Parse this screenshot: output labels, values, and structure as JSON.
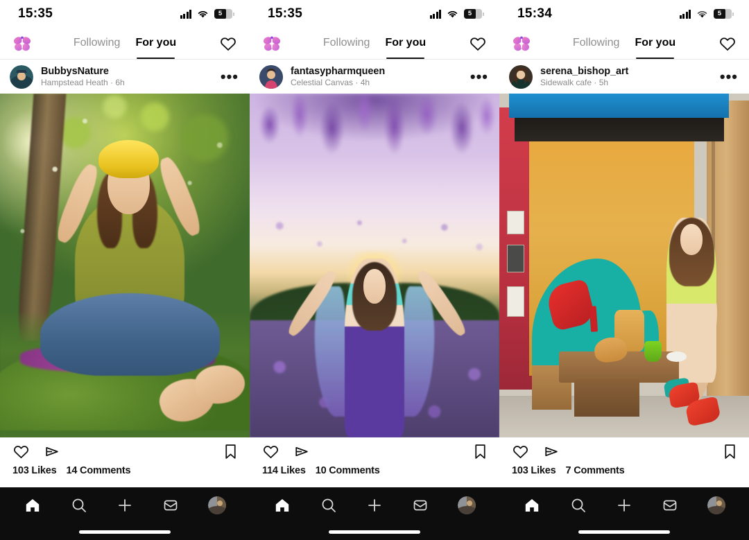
{
  "app": {
    "logo_icon": "butterfly-logo-icon",
    "accent": "#b33bd6",
    "nav_bg": "#0d0d0d"
  },
  "panels": [
    {
      "status": {
        "time": "15:35",
        "signal_icon": "cellular-signal-icon",
        "wifi_icon": "wifi-icon",
        "battery_icon": "battery-icon",
        "battery_level": "5"
      },
      "topbar": {
        "tab_following": "Following",
        "tab_for_you": "For you",
        "active_tab": "For you",
        "activity_icon": "heart-outline-icon"
      },
      "post": {
        "username": "BubbysNature",
        "subtitle": "Hampstead Heath · 6h",
        "menu_icon": "more-options-icon",
        "avatar_icon": "user-avatar",
        "like_icon": "heart-outline-icon",
        "share_icon": "share-paper-plane-icon",
        "save_icon": "bookmark-outline-icon",
        "likes": "103 Likes",
        "comments": "14 Comments",
        "image_alt": "man-meditating-in-forest"
      },
      "nav": {
        "home_icon": "home-filled-icon",
        "search_icon": "search-icon",
        "create_icon": "plus-icon",
        "inbox_icon": "inbox-tray-icon",
        "profile_icon": "profile-avatar-icon"
      }
    },
    {
      "status": {
        "time": "15:35",
        "signal_icon": "cellular-signal-icon",
        "wifi_icon": "wifi-icon",
        "battery_icon": "battery-icon",
        "battery_level": "5"
      },
      "topbar": {
        "tab_following": "Following",
        "tab_for_you": "For you",
        "active_tab": "For you",
        "activity_icon": "heart-outline-icon"
      },
      "post": {
        "username": "fantasypharmqueen",
        "subtitle": "Celestial Canvas · 4h",
        "menu_icon": "more-options-icon",
        "avatar_icon": "user-avatar",
        "like_icon": "heart-outline-icon",
        "share_icon": "share-paper-plane-icon",
        "save_icon": "bookmark-outline-icon",
        "likes": "114 Likes",
        "comments": "10 Comments",
        "image_alt": "woman-in-wisteria-field-at-sunset"
      },
      "nav": {
        "home_icon": "home-filled-icon",
        "search_icon": "search-icon",
        "create_icon": "plus-icon",
        "inbox_icon": "inbox-tray-icon",
        "profile_icon": "profile-avatar-icon"
      }
    },
    {
      "status": {
        "time": "15:34",
        "signal_icon": "cellular-signal-icon",
        "wifi_icon": "wifi-icon",
        "battery_icon": "battery-icon",
        "battery_level": "5"
      },
      "topbar": {
        "tab_following": "Following",
        "tab_for_you": "For you",
        "active_tab": "For you",
        "activity_icon": "heart-outline-icon"
      },
      "post": {
        "username": "serena_bishop_art",
        "subtitle": "Sidewalk cafe · 5h",
        "menu_icon": "more-options-icon",
        "avatar_icon": "user-avatar",
        "like_icon": "heart-outline-icon",
        "share_icon": "share-paper-plane-icon",
        "save_icon": "bookmark-outline-icon",
        "likes": "103 Likes",
        "comments": "7 Comments",
        "image_alt": "woman-seated-at-colourful-sidewalk-cafe"
      },
      "nav": {
        "home_icon": "home-filled-icon",
        "search_icon": "search-icon",
        "create_icon": "plus-icon",
        "inbox_icon": "inbox-tray-icon",
        "profile_icon": "profile-avatar-icon"
      }
    }
  ]
}
